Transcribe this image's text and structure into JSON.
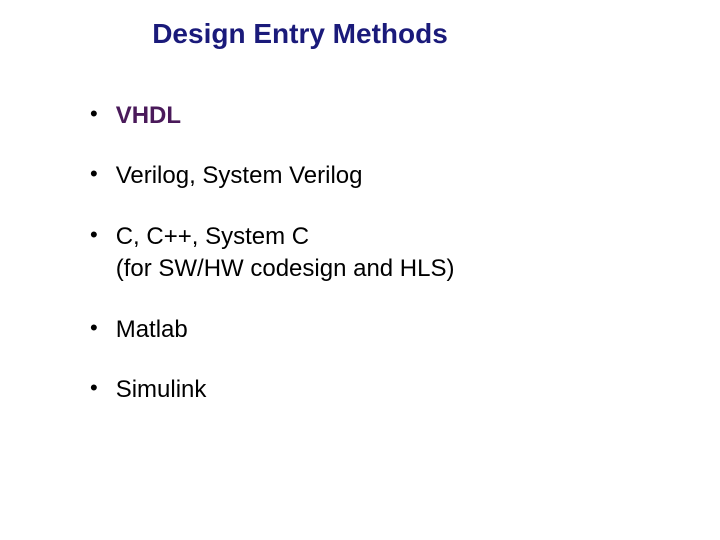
{
  "title": "Design Entry Methods",
  "items": [
    {
      "text": "VHDL",
      "highlighted": true
    },
    {
      "text": "Verilog, System Verilog",
      "highlighted": false
    },
    {
      "text": "C, C++, System C\n(for SW/HW codesign and HLS)",
      "highlighted": false
    },
    {
      "text": "Matlab",
      "highlighted": false
    },
    {
      "text": "Simulink",
      "highlighted": false
    }
  ],
  "bullet_char": "•"
}
